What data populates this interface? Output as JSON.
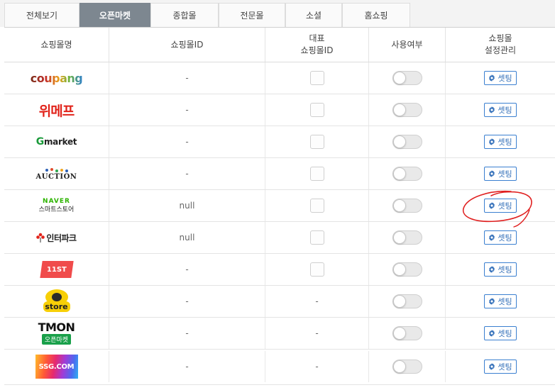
{
  "tabs": [
    {
      "label": "전체보기",
      "active": false
    },
    {
      "label": "오픈마켓",
      "active": true
    },
    {
      "label": "종합몰",
      "active": false
    },
    {
      "label": "전문몰",
      "active": false
    },
    {
      "label": "소셜",
      "active": false
    },
    {
      "label": "홈쇼핑",
      "active": false
    }
  ],
  "header": {
    "mall_name": "쇼핑몰명",
    "mall_id": "쇼핑몰ID",
    "rep_line1": "대표",
    "rep_line2": "쇼핑몰ID",
    "use": "사용여부",
    "settings_line1": "쇼핑몰",
    "settings_line2": "설정관리"
  },
  "colors": {
    "active_tab": "#7d8790",
    "button_border": "#3a7fd0",
    "annotation": "#e02020"
  },
  "rows": [
    {
      "mall": "coupang",
      "mall_id": "-",
      "rep_id": "checkbox",
      "enabled": false,
      "setting_label": "셋팅",
      "setting_icon": "gear-icon"
    },
    {
      "mall": "위메프",
      "mall_id": "-",
      "rep_id": "checkbox",
      "enabled": false,
      "setting_label": "셋팅",
      "setting_icon": "gear-icon"
    },
    {
      "mall": "Gmarket",
      "mall_id": "-",
      "rep_id": "checkbox",
      "enabled": false,
      "setting_label": "셋팅",
      "setting_icon": "gear-icon"
    },
    {
      "mall": "AUCTION",
      "mall_id": "-",
      "rep_id": "checkbox",
      "enabled": false,
      "setting_label": "셋팅",
      "setting_icon": "gear-icon"
    },
    {
      "mall": "NAVER",
      "mall_sub": "스마트스토어",
      "mall_id": "null",
      "rep_id": "checkbox",
      "enabled": false,
      "setting_label": "셋팅",
      "setting_icon": "gear-icon"
    },
    {
      "mall": "인터파크",
      "mall_id": "null",
      "rep_id": "checkbox",
      "enabled": false,
      "setting_label": "셋팅",
      "setting_icon": "gear-icon"
    },
    {
      "mall": "11ST",
      "mall_id": "-",
      "rep_id": "checkbox",
      "enabled": false,
      "setting_label": "셋팅",
      "setting_icon": "gear-icon"
    },
    {
      "mall": "store",
      "mall_id": "-",
      "rep_id": "-",
      "enabled": false,
      "setting_label": "셋팅",
      "setting_icon": "gear-icon"
    },
    {
      "mall": "TMON",
      "mall_sub": "오픈마켓",
      "mall_id": "-",
      "rep_id": "-",
      "enabled": false,
      "setting_label": "셋팅",
      "setting_icon": "gear-icon"
    },
    {
      "mall": "SSG.COM",
      "mall_id": "-",
      "rep_id": "-",
      "enabled": false,
      "setting_label": "셋팅",
      "setting_icon": "gear-icon"
    }
  ]
}
